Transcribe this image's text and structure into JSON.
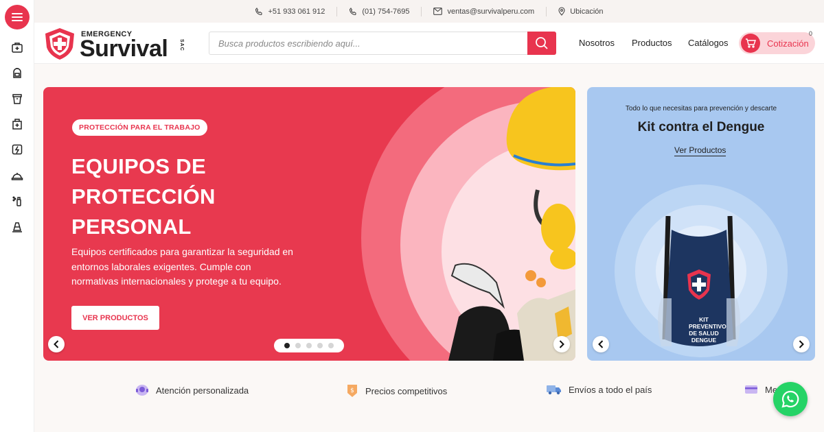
{
  "topbar": {
    "phone": "+51 933 061 912",
    "landline": "(01) 754-7695",
    "email": "ventas@survivalperu.com",
    "location": "Ubicación"
  },
  "logo": {
    "top_line": "EMERGENCY",
    "main": "Survival",
    "suffix": "SAC"
  },
  "search": {
    "placeholder": "Busca productos escribiendo aquí..."
  },
  "nav": {
    "items": [
      "Nosotros",
      "Productos",
      "Catálogos"
    ],
    "quote_label": "Cotización",
    "quote_count": "0"
  },
  "hero": {
    "badge": "PROTECCIÓN PARA EL TRABAJO",
    "title": "EQUIPOS DE PROTECCIÓN PERSONAL",
    "description": "Equipos certificados para garantizar la seguridad en entornos laborales exigentes. Cumple con normativas internacionales y protege a tu equipo.",
    "cta": "VER PRODUCTOS",
    "slide_count": 5,
    "active_slide": 1
  },
  "promo": {
    "subtitle": "Todo lo que necesitas para prevención y descarte",
    "title": "Kit contra el Dengue",
    "link": "Ver Productos",
    "bag_text": "KIT PREVENTIVO DE SALUD DENGUE"
  },
  "features": [
    "Atención personalizada",
    "Precios competitivos",
    "Envíos a todo el país",
    "Me"
  ],
  "colors": {
    "brand_red": "#e8344e",
    "promo_blue": "#a8c8f0",
    "whatsapp": "#25d366"
  }
}
